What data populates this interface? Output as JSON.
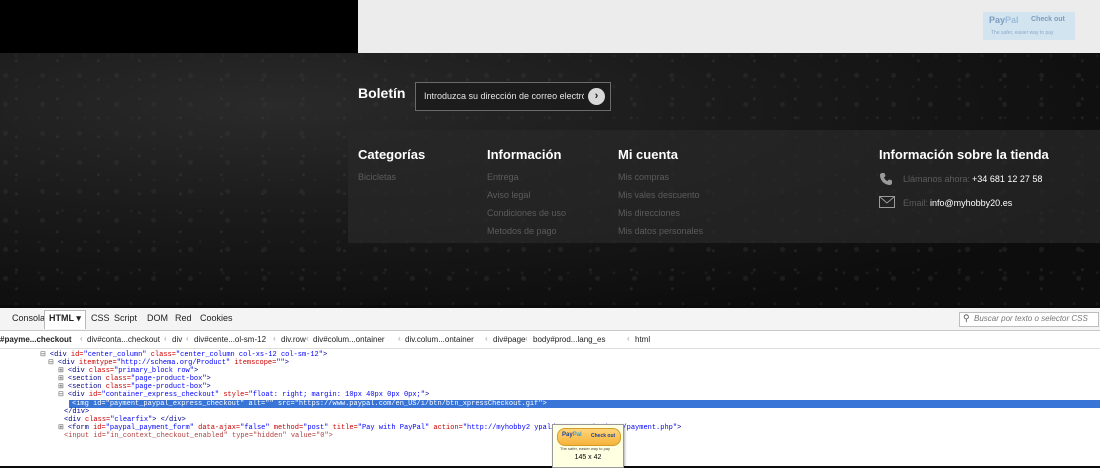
{
  "paypal_badge": {
    "brand_pay": "Pay",
    "brand_pal": "Pal",
    "checkout": "Check out",
    "tagline": "The safer, easier way to pay"
  },
  "newsletter": {
    "title": "Boletín",
    "placeholder": "Introduzca su dirección de correo electrónico",
    "submit_glyph": "›"
  },
  "footer": {
    "categories": {
      "title": "Categorías",
      "items": [
        "Bicicletas"
      ]
    },
    "info": {
      "title": "Información",
      "items": [
        "Entrega",
        "Aviso legal",
        "Condiciones de uso",
        "Metodos de pago"
      ]
    },
    "account": {
      "title": "Mi cuenta",
      "items": [
        "Mis compras",
        "Mis vales descuento",
        "Mis direcciones",
        "Mis datos personales"
      ]
    },
    "store": {
      "title": "Información sobre la tienda",
      "phone_label": "Llámanos ahora:",
      "phone_value": "+34 681 12 27 58",
      "email_label": "Email:",
      "email_value": "info@myhobby20.es",
      "phone_icon": "phone-icon",
      "email_icon": "envelope-icon"
    }
  },
  "devtools": {
    "tabs": [
      "Consola",
      "HTML ▾",
      "CSS",
      "Script",
      "DOM",
      "Red",
      "Cookies"
    ],
    "active_tab": "HTML ▾",
    "search_placeholder": "Buscar por texto o selector CSS",
    "breadcrumbs": [
      "#payme...checkout",
      "div#conta...checkout",
      "div",
      "div#cente...ol-sm-12",
      "div.row",
      "div#colum...ontainer",
      "div.colum...ontainer",
      "div#page",
      "body#prod...lang_es",
      "html"
    ],
    "code_lines": [
      {
        "ex": "⊟",
        "parts": [
          [
            "tg",
            "<div "
          ],
          [
            "at",
            "id="
          ],
          [
            "av",
            "\"center_column\""
          ],
          [
            "at",
            " class="
          ],
          [
            "av",
            "\"center_column col-xs-12 col-sm-12\""
          ],
          [
            "tg",
            ">"
          ]
        ]
      },
      {
        "ex": "⊟",
        "parts": [
          [
            "tg",
            "<div "
          ],
          [
            "at",
            "itemtype="
          ],
          [
            "av",
            "\"http://schema.org/Product\""
          ],
          [
            "at",
            " itemscope="
          ],
          [
            "av",
            "\"\""
          ],
          [
            "tg",
            ">"
          ]
        ]
      },
      {
        "ex": "⊞",
        "parts": [
          [
            "tg",
            "<div "
          ],
          [
            "at",
            "class="
          ],
          [
            "av",
            "\"primary_block row\""
          ],
          [
            "tg",
            ">"
          ]
        ]
      },
      {
        "ex": "⊞",
        "parts": [
          [
            "tg",
            "<section "
          ],
          [
            "at",
            "class="
          ],
          [
            "av",
            "\"page-product-box\""
          ],
          [
            "tg",
            ">"
          ]
        ]
      },
      {
        "ex": "⊞",
        "parts": [
          [
            "tg",
            "<section "
          ],
          [
            "at",
            "class="
          ],
          [
            "av",
            "\"page-product-box\""
          ],
          [
            "tg",
            ">"
          ]
        ]
      },
      {
        "ex": "⊟",
        "parts": [
          [
            "tg",
            "<div "
          ],
          [
            "at",
            "id="
          ],
          [
            "av",
            "\"container_express_checkout\""
          ],
          [
            "at",
            " style="
          ],
          [
            "av",
            "\"float: right; margin: 10px 40px 0px 0px;\""
          ],
          [
            "tg",
            ">"
          ]
        ]
      },
      {
        "ex": "",
        "parts": [
          [
            "tg",
            "<img "
          ],
          [
            "at",
            "id="
          ],
          [
            "av",
            "\"payment_paypal_express_checkout\""
          ],
          [
            "at",
            " alt="
          ],
          [
            "av",
            "\"\""
          ],
          [
            "at",
            " src="
          ],
          [
            "av",
            "\"https://www.paypal.com/en_US/i/btn/btn_xpressCheckout.gif\""
          ],
          [
            "tg",
            ">"
          ]
        ]
      },
      {
        "ex": "",
        "parts": [
          [
            "tg",
            "</div>"
          ]
        ]
      },
      {
        "ex": "",
        "parts": [
          [
            "tg",
            "<div "
          ],
          [
            "at",
            "class="
          ],
          [
            "av",
            "\"clearfix\""
          ],
          [
            "tg",
            "> </div>"
          ]
        ]
      },
      {
        "ex": "⊞",
        "parts": [
          [
            "tg",
            "<form "
          ],
          [
            "at",
            "id="
          ],
          [
            "av",
            "\"paypal_payment_form\""
          ],
          [
            "at",
            " data-ajax="
          ],
          [
            "av",
            "\"false\""
          ],
          [
            "at",
            " method="
          ],
          [
            "av",
            "\"post\""
          ],
          [
            "at",
            " title="
          ],
          [
            "av",
            "\"Pay with PayPal\""
          ],
          [
            "at",
            " action="
          ],
          [
            "av",
            "\"http://myhobby2"
          ],
          [
            "tx",
            "                 "
          ],
          [
            "av",
            "ypal/express_checkout/payment.php\""
          ],
          [
            "tg",
            ">"
          ]
        ]
      },
      {
        "ex": "",
        "parts": [
          [
            "tw",
            "<input id=\"in_context_checkout_enabled\" type=\"hidden\" value=\"0\">"
          ]
        ]
      }
    ],
    "tooltip": {
      "brand_pay": "Pay",
      "brand_pal": "Pal",
      "checkout": "Check out",
      "tagline": "The safer, easier way to pay",
      "size": "145 x 42"
    }
  }
}
